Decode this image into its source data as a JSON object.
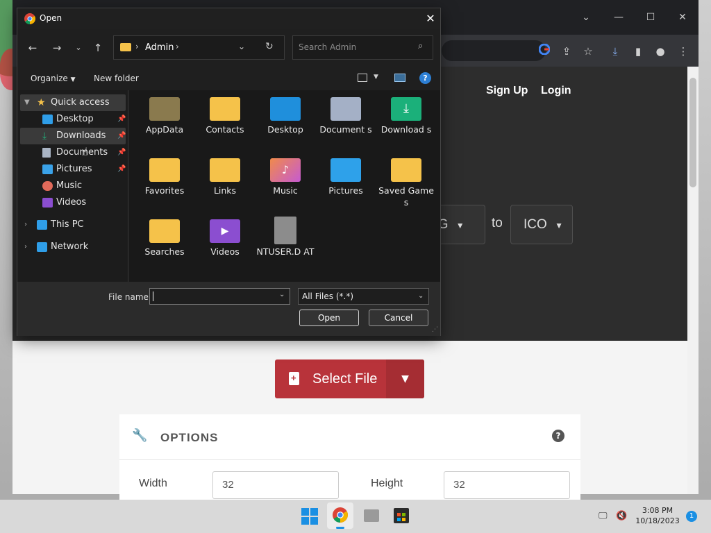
{
  "dialog": {
    "title": "Open",
    "path": "Admin",
    "search_placeholder": "Search Admin",
    "organize": "Organize",
    "new_folder": "New folder",
    "nav": {
      "quick_access": "Quick access",
      "pinned": [
        {
          "label": "Desktop",
          "icon": "desktop-icon"
        },
        {
          "label": "Downloads",
          "icon": "download-icon"
        },
        {
          "label": "Documents",
          "icon": "documents-icon"
        },
        {
          "label": "Pictures",
          "icon": "pictures-icon"
        },
        {
          "label": "Music",
          "icon": "music-icon"
        },
        {
          "label": "Videos",
          "icon": "videos-icon"
        }
      ],
      "this_pc": "This PC",
      "network": "Network"
    },
    "files": [
      {
        "name": "AppData",
        "icon": "folder-dim"
      },
      {
        "name": "Contacts",
        "icon": "folder"
      },
      {
        "name": "Desktop",
        "icon": "folder-desktop"
      },
      {
        "name": "Document s",
        "icon": "folder-documents"
      },
      {
        "name": "Download s",
        "icon": "folder-downloads"
      },
      {
        "name": "Favorites",
        "icon": "folder"
      },
      {
        "name": "Links",
        "icon": "folder"
      },
      {
        "name": "Music",
        "icon": "folder-music"
      },
      {
        "name": "Pictures",
        "icon": "folder-pictures"
      },
      {
        "name": "Saved Games",
        "icon": "folder"
      },
      {
        "name": "Searches",
        "icon": "folder"
      },
      {
        "name": "Videos",
        "icon": "folder-videos"
      },
      {
        "name": "NTUSER.D AT",
        "icon": "file"
      }
    ],
    "file_name_label": "File name:",
    "file_name_value": "",
    "filter": "All Files (*.*)",
    "open": "Open",
    "cancel": "Cancel"
  },
  "page": {
    "sign_up": "Sign Up",
    "login": "Login",
    "from_format": "NG",
    "to_word": "to",
    "to_format": "ICO",
    "select_file": "Select File",
    "options_title": "OPTIONS",
    "width_label": "Width",
    "width_value": "32",
    "height_label": "Height",
    "height_value": "32"
  },
  "taskbar": {
    "time": "3:08 PM",
    "date": "10/18/2023",
    "notifications": "1"
  },
  "colors": {
    "accent_red": "#b8333a",
    "folder_yellow": "#f5c24a",
    "dialog_bg": "#1f1f1f"
  }
}
